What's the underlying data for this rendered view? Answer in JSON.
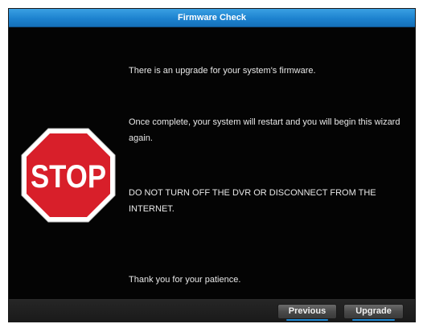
{
  "window": {
    "title": "Firmware Check"
  },
  "stop_sign": {
    "text": "STOP",
    "fill_color": "#d81f2a",
    "border_color": "#ffffff"
  },
  "messages": {
    "line1": "There is an upgrade for your system's firmware.",
    "line2": "Once complete, your system will restart and you will begin this wizard again.",
    "line3": "DO NOT TURN OFF THE DVR OR DISCONNECT FROM THE INTERNET.",
    "line4": "Thank you for your patience."
  },
  "buttons": {
    "previous_label": "Previous",
    "upgrade_label": "Upgrade"
  },
  "colors": {
    "titlebar": "#1d82cf",
    "background": "#040404",
    "button_underline": "#1e8ad6"
  }
}
